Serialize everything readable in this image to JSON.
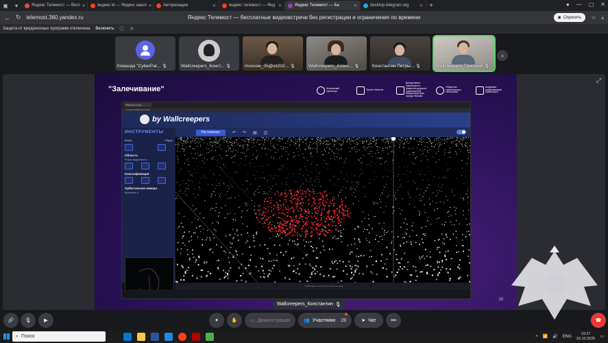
{
  "browser": {
    "tabs": [
      {
        "title": "Яндекс Телемост — бесп",
        "color": "#e74c3c"
      },
      {
        "title": "яндекс id — Яндекс нашл",
        "color": "#fc3f1d"
      },
      {
        "title": "Авторизация",
        "color": "#fc3f1d"
      },
      {
        "title": "яндекс телемост — Янд",
        "color": "#fc3f1d"
      },
      {
        "title": "Яндекс Телемост — Бе",
        "color": "#8e44ad",
        "active": true
      },
      {
        "title": "desktop.telegram.org",
        "color": "#2aa3de"
      }
    ],
    "url": "telemost.360.yandex.ru",
    "page_title": "Яндекс Телемост — бесплатные видеовстречи без регистрации и ограничения по времени",
    "ask_button": "Спросить",
    "protection_text": "Защита от вредоносных программ отключена",
    "protection_button": "Включить"
  },
  "participants": [
    {
      "name": "Команда \"CyberPat...",
      "kind": "avatar"
    },
    {
      "name": "Wallcreepers_Конст...",
      "kind": "logo"
    },
    {
      "name": "moscow_05@ict202...",
      "kind": "photo"
    },
    {
      "name": "Wallcreepers_Алекс...",
      "kind": "photo"
    },
    {
      "name": "Константин Петры...",
      "kind": "photo"
    },
    {
      "name": "Wallcreepers_Григорий",
      "kind": "photo",
      "speaking": true
    }
  ],
  "slide": {
    "title": "\"Залечивание\"",
    "logos": [
      "Московский транспорт",
      "Проект Moscow",
      "Департамент транспорта и развития дорожно-транспортной инфраструктуры города Москвы",
      "Общество транспортных технологий",
      "Академия цифровизации транспорта"
    ],
    "page_number": "10"
  },
  "app": {
    "tab_title": "Wallcreepers app",
    "url": "localhost:3000/point-cloud",
    "brand": "by Wallcreepers",
    "home_button": "На главную",
    "sidebar_title": "ИНСТРУМЕНТЫ",
    "brush_label": "Кисть",
    "reset_label": "Сброс",
    "area_section": "Область",
    "area_hint": "Режим выделения ●",
    "classification_section": "Классификация",
    "camera_section": "Орбитальная камера",
    "camera_hint": "Вращение ●",
    "footer": "© 2025 Здесь могла быть ваша реклама"
  },
  "speaker_label": "Wallcreepers_Константин",
  "controls": {
    "demo_label": "Демонстрация",
    "participants_label": "Участники",
    "participants_count": "28",
    "chat_label": "Чат"
  },
  "taskbar": {
    "search_placeholder": "Поиск",
    "lang": "ENG",
    "time": "19:27",
    "date": "20.10.2025"
  }
}
